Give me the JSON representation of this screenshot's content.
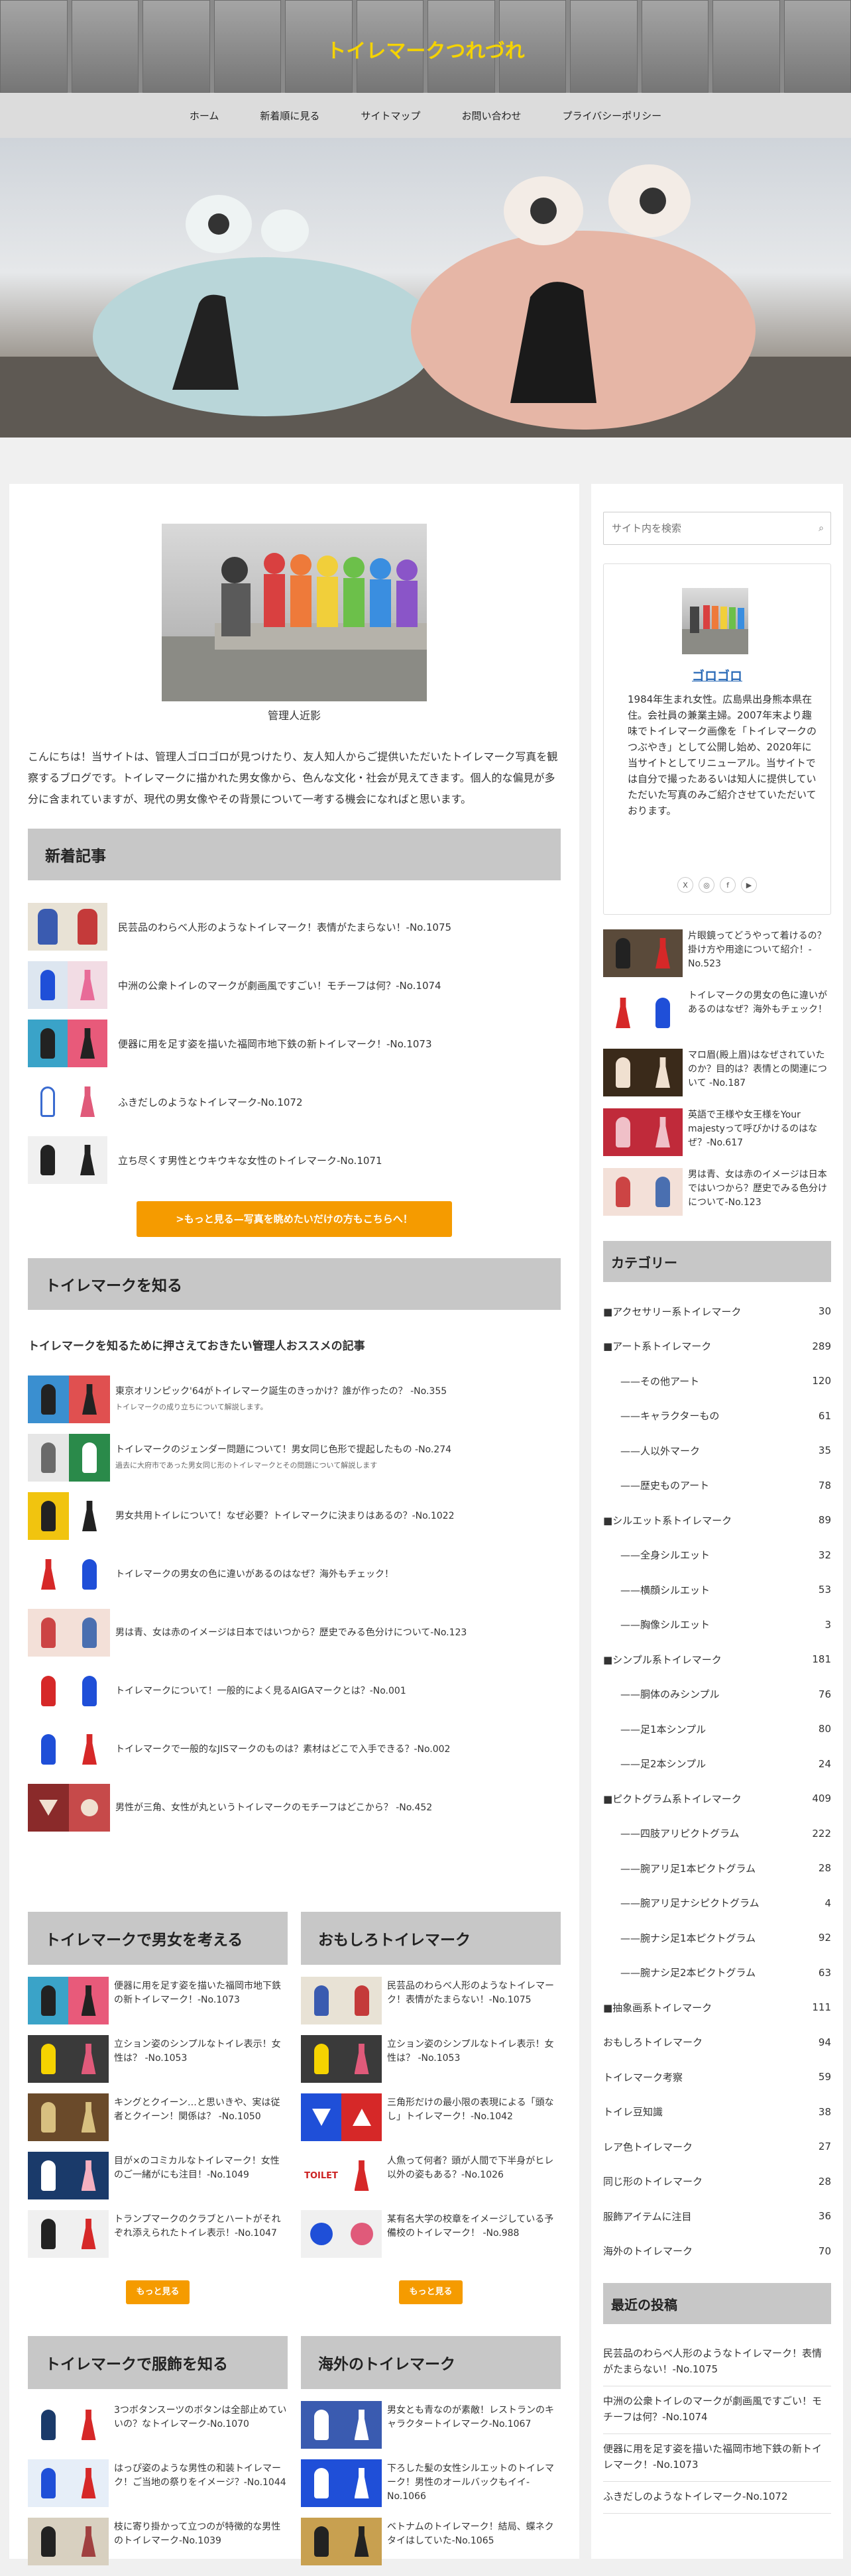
{
  "site": {
    "title": "トイレマークつれづれ",
    "nav": [
      "ホーム",
      "新着順に見る",
      "サイトマップ",
      "お問い合わせ",
      "プライバシーポリシー"
    ]
  },
  "intro": {
    "caption": "管理人近影",
    "text": "こんにちは！当サイトは、管理人ゴロゴロが見つけたり、友人知人からご提供いただいたトイレマーク写真を観察するブログです。トイレマークに描かれた男女像から、色んな文化・社会が見えてきます。個人的な偏見が多分に含まれていますが、現代の男女像やその背景について一考する機会になればと思います。"
  },
  "new_articles": {
    "heading": "新着記事",
    "items": [
      "民芸品のわらべ人形のようなトイレマーク！表情がたまらない！-No.1075",
      "中洲の公衆トイレのマークが劇画風ですごい！モチーフは何？-No.1074",
      "便器に用を足す姿を描いた福岡市地下鉄の新トイレマーク！-No.1073",
      "ふきだしのようなトイレマーク-No.1072",
      "立ち尽くす男性とウキウキな女性のトイレマーク-No.1071"
    ],
    "more": ">もっと見る—写真を眺めたいだけの方もこちらへ！"
  },
  "learn": {
    "heading": "トイレマークを知る",
    "subhead": "トイレマークを知るために押さえておきたい管理人おススメの記事",
    "items": [
      {
        "title": "東京オリンピック'64がトイレマーク誕生のきっかけ？誰が作ったの？ -No.355",
        "sub": "トイレマークの成り立ちについて解説します。"
      },
      {
        "title": "トイレマークのジェンダー問題について！男女同じ色形で提起したもの -No.274",
        "sub": "過去に大府市であった男女同じ形のトイレマークとその問題について解説します"
      },
      {
        "title": "男女共用トイレについて！なぜ必要？トイレマークに決まりはあるの？-No.1022",
        "sub": ""
      },
      {
        "title": "トイレマークの男女の色に違いがあるのはなぜ？海外もチェック！",
        "sub": ""
      },
      {
        "title": "男は青、女は赤のイメージは日本ではいつから？歴史でみる色分けについて-No.123",
        "sub": ""
      },
      {
        "title": "トイレマークについて！一般的によく見るAIGAマークとは？-No.001",
        "sub": ""
      },
      {
        "title": "トイレマークで一般的なJISマークのものは？素材はどこで入手できる？-No.002",
        "sub": ""
      },
      {
        "title": "男性が三角、女性が丸というトイレマークのモチーフはどこから？ -No.452",
        "sub": ""
      }
    ]
  },
  "gender": {
    "heading": "トイレマークで男女を考える",
    "items": [
      "便器に用を足す姿を描いた福岡市地下鉄の新トイレマーク！-No.1073",
      "立ション姿のシンプルなトイレ表示！女性は？ -No.1053",
      "キングとクイーン…と思いきや、実は従者とクイーン！関係は？ -No.1050",
      "目が×のコミカルなトイレマーク！女性のご一緒がにも注目！-No.1049",
      "トランプマークのクラブとハートがそれぞれ添えられたトイレ表示！-No.1047"
    ],
    "more": "もっと見る"
  },
  "funny": {
    "heading": "おもしろトイレマーク",
    "items": [
      "民芸品のわらべ人形のようなトイレマーク！表情がたまらない！-No.1075",
      "立ション姿のシンプルなトイレ表示！女性は？ -No.1053",
      "三角形だけの最小限の表現による「頭なし」トイレマーク！-No.1042",
      "人魚って何者？頭が人間で下半身がヒレ以外の姿もある？-No.1026",
      "某有名大学の校章をイメージしている予備校のトイレマーク！ -No.988"
    ],
    "more": "もっと見る"
  },
  "clothing": {
    "heading": "トイレマークで服飾を知る",
    "items": [
      "3つボタンスーツのボタンは全部止めていいの？なトイレマーク-No.1070",
      "はっぴ姿のような男性の和装トイレマーク！ご当地の祭りをイメージ？-No.1044",
      "枝に寄り掛かって立つのが特徴的な男性のトイレマーク-No.1039"
    ]
  },
  "overseas": {
    "heading": "海外のトイレマーク",
    "items": [
      "男女とも青なのが素敵！レストランのキャラクタートイレマーク-No.1067",
      "下ろした髪の女性シルエットのトイレマーク！男性のオールバックもイイ-No.1066",
      "ベトナムのトイレマーク！結局、蝶ネクタイはしていた-No.1065"
    ]
  },
  "sidebar": {
    "search_placeholder": "サイト内を検索",
    "profile": {
      "name": "ゴロゴロ",
      "text": "1984年生まれ女性。広島県出身熊本県在住。会社員の兼業主婦。2007年末より趣味でトイレマーク画像を「トイレマークのつぶやき」として公開し始め、2020年に当サイトとしてリニューアル。当サイトでは自分で撮ったあるいは知人に提供していただいた写真のみご紹介させていただいております。",
      "sns": [
        "X",
        "◎",
        "f",
        "▶"
      ]
    },
    "popular": [
      "片眼鏡ってどうやって着けるの？掛け方や用途について紹介！-No.523",
      "トイレマークの男女の色に違いがあるのはなぜ？海外もチェック！",
      "マロ眉(殿上眉)はなぜされていたのか？目的は？表情との関連について -No.187",
      "英語で王様や女王様をYour majestyって呼びかけるのはなぜ？-No.617",
      "男は青、女は赤のイメージは日本ではいつから？歴史でみる色分けについて-No.123"
    ],
    "category_heading": "カテゴリー",
    "categories": [
      {
        "label": "■アクセサリー系トイレマーク",
        "count": "30",
        "sub": false
      },
      {
        "label": "■アート系トイレマーク",
        "count": "289",
        "sub": false
      },
      {
        "label": "——その他アート",
        "count": "120",
        "sub": true
      },
      {
        "label": "——キャラクターもの",
        "count": "61",
        "sub": true
      },
      {
        "label": "——人以外マーク",
        "count": "35",
        "sub": true
      },
      {
        "label": "——歴史ものアート",
        "count": "78",
        "sub": true
      },
      {
        "label": "■シルエット系トイレマーク",
        "count": "89",
        "sub": false
      },
      {
        "label": "——全身シルエット",
        "count": "32",
        "sub": true
      },
      {
        "label": "——横顔シルエット",
        "count": "53",
        "sub": true
      },
      {
        "label": "——胸像シルエット",
        "count": "3",
        "sub": true
      },
      {
        "label": "■シンプル系トイレマーク",
        "count": "181",
        "sub": false
      },
      {
        "label": "——胴体のみシンプル",
        "count": "76",
        "sub": true
      },
      {
        "label": "——足1本シンプル",
        "count": "80",
        "sub": true
      },
      {
        "label": "——足2本シンプル",
        "count": "24",
        "sub": true
      },
      {
        "label": "■ピクトグラム系トイレマーク",
        "count": "409",
        "sub": false
      },
      {
        "label": "——四肢アリピクトグラム",
        "count": "222",
        "sub": true
      },
      {
        "label": "——腕アリ足1本ピクトグラム",
        "count": "28",
        "sub": true
      },
      {
        "label": "——腕アリ足ナシピクトグラム",
        "count": "4",
        "sub": true
      },
      {
        "label": "——腕ナシ足1本ピクトグラム",
        "count": "92",
        "sub": true
      },
      {
        "label": "——腕ナシ足2本ピクトグラム",
        "count": "63",
        "sub": true
      },
      {
        "label": "■抽象画系トイレマーク",
        "count": "111",
        "sub": false
      },
      {
        "label": "おもしろトイレマーク",
        "count": "94",
        "sub": false
      },
      {
        "label": "トイレマーク考察",
        "count": "59",
        "sub": false
      },
      {
        "label": "トイレ豆知識",
        "count": "38",
        "sub": false
      },
      {
        "label": "レア色トイレマーク",
        "count": "27",
        "sub": false
      },
      {
        "label": "同じ形のトイレマーク",
        "count": "28",
        "sub": false
      },
      {
        "label": "服飾アイテムに注目",
        "count": "36",
        "sub": false
      },
      {
        "label": "海外のトイレマーク",
        "count": "70",
        "sub": false
      }
    ],
    "recent_heading": "最近の投稿",
    "recent": [
      "民芸品のわらべ人形のようなトイレマーク！表情がたまらない！-No.1075",
      "中洲の公衆トイレのマークが劇画風ですごい！モチーフは何？-No.1074",
      "便器に用を足す姿を描いた福岡市地下鉄の新トイレマーク！-No.1073",
      "ふきだしのようなトイレマーク-No.1072"
    ]
  }
}
